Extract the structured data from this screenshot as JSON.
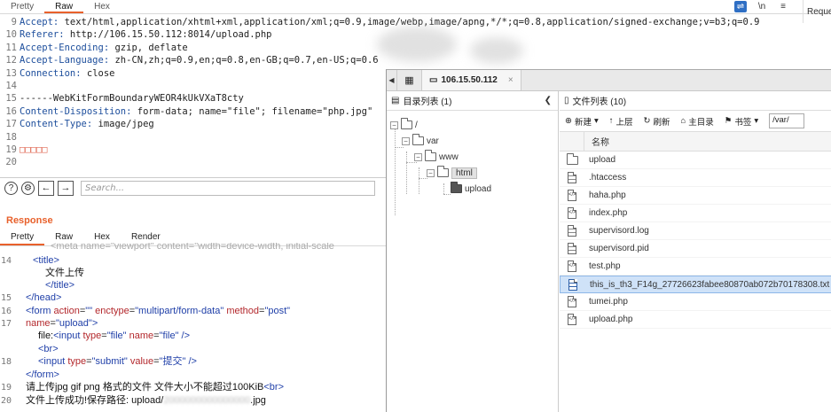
{
  "burp": {
    "top_tabs": [
      "Pretty",
      "Raw",
      "Hex"
    ],
    "top_icons": [
      "⇌",
      "\\n",
      "≡"
    ],
    "side_label": "Reque",
    "request_lines": [
      {
        "n": "9",
        "k": "Accept:",
        "v": " text/html,application/xhtml+xml,application/xml;q=0.9,image/webp,image/apng,*/*;q=0.8,application/signed-exchange;v=b3;q=0.9"
      },
      {
        "n": "10",
        "k": "Referer:",
        "v": " http://106.15.50.112:8014/upload.php"
      },
      {
        "n": "11",
        "k": "Accept-Encoding:",
        "v": " gzip, deflate"
      },
      {
        "n": "12",
        "k": "Accept-Language:",
        "v": " zh-CN,zh;q=0.9,en;q=0.8,en-GB;q=0.7,en-US;q=0.6"
      },
      {
        "n": "13",
        "k": "Connection:",
        "v": " close"
      },
      {
        "n": "14",
        "k": "",
        "v": ""
      },
      {
        "n": "15",
        "k": "",
        "v": "------WebKitFormBoundaryWEOR4kUkVXaT8cty"
      },
      {
        "n": "16",
        "k": "Content-Disposition:",
        "v": " form-data; name=\"file\"; filename=\"php.jpg\""
      },
      {
        "n": "17",
        "k": "Content-Type:",
        "v": " image/jpeg"
      },
      {
        "n": "18",
        "k": "",
        "v": ""
      },
      {
        "n": "19",
        "k": "",
        "v": "",
        "sq": "□□□□□"
      },
      {
        "n": "20",
        "k": "",
        "v": ""
      }
    ],
    "search_placeholder": "Search...",
    "help_icon": "?",
    "response_title": "Response",
    "response_tabs": [
      "Pretty",
      "Raw",
      "Hex",
      "Render"
    ],
    "response_lines": {
      "l13": "<meta name=\"viewport\" content=\"width=device-width, initial-scale",
      "l14": "<title>",
      "l14b": "文件上传",
      "l14c": "</title>",
      "l15": "</head>",
      "l16_tag": "<form",
      "l16_a1": "action",
      "l16_v1": "\"\"",
      "l16_a2": "enctype",
      "l16_v2": "\"multipart/form-data\"",
      "l16_a3": "method",
      "l16_v3": "\"post\"",
      "l16b_a": "name",
      "l16b_v": "\"upload\"",
      "l16b_end": ">",
      "l17_text": "file:",
      "l17_tag": "<input",
      "l17_a1": "type",
      "l17_v1": "\"file\"",
      "l17_a2": "name",
      "l17_v2": "\"file\"",
      "l17_end": "/>",
      "l17b": "<br>",
      "l18_tag": "<input",
      "l18_a1": "type",
      "l18_v1": "\"submit\"",
      "l18_a2": "value",
      "l18_v2": "\"提交\"",
      "l18_end": "/>",
      "l18b": "</form>",
      "l19_text": "请上传jpg gif png 格式的文件  文件大小不能超过100KiB",
      "l19_tag": "<br>",
      "l20_text": "文件上传成功!保存路径:  upload/",
      "l20_blur": "2000000000000000",
      "l20_end": ".jpg"
    }
  },
  "filemanager": {
    "address": "106.15.50.112",
    "close": "×",
    "dir_title": "目录列表 (1)",
    "file_title": "文件列表 (10)",
    "tree": [
      "/",
      "var",
      "www",
      "html",
      "upload"
    ],
    "toolbar": {
      "new": "新建",
      "up": "上层",
      "refresh": "刷新",
      "home": "主目录",
      "bookmark": "书签",
      "path": "/var/"
    },
    "col_name": "名称",
    "files": [
      {
        "name": "upload",
        "kind": "folder"
      },
      {
        "name": ".htaccess",
        "kind": "text"
      },
      {
        "name": "haha.php",
        "kind": "code"
      },
      {
        "name": "index.php",
        "kind": "code"
      },
      {
        "name": "supervisord.log",
        "kind": "text"
      },
      {
        "name": "supervisord.pid",
        "kind": "text"
      },
      {
        "name": "test.php",
        "kind": "code"
      },
      {
        "name": "this_is_th3_F14g_27726623fabee80870ab072b70178308.txt",
        "kind": "text",
        "selected": true
      },
      {
        "name": "tumei.php",
        "kind": "code"
      },
      {
        "name": "upload.php",
        "kind": "code"
      }
    ]
  }
}
